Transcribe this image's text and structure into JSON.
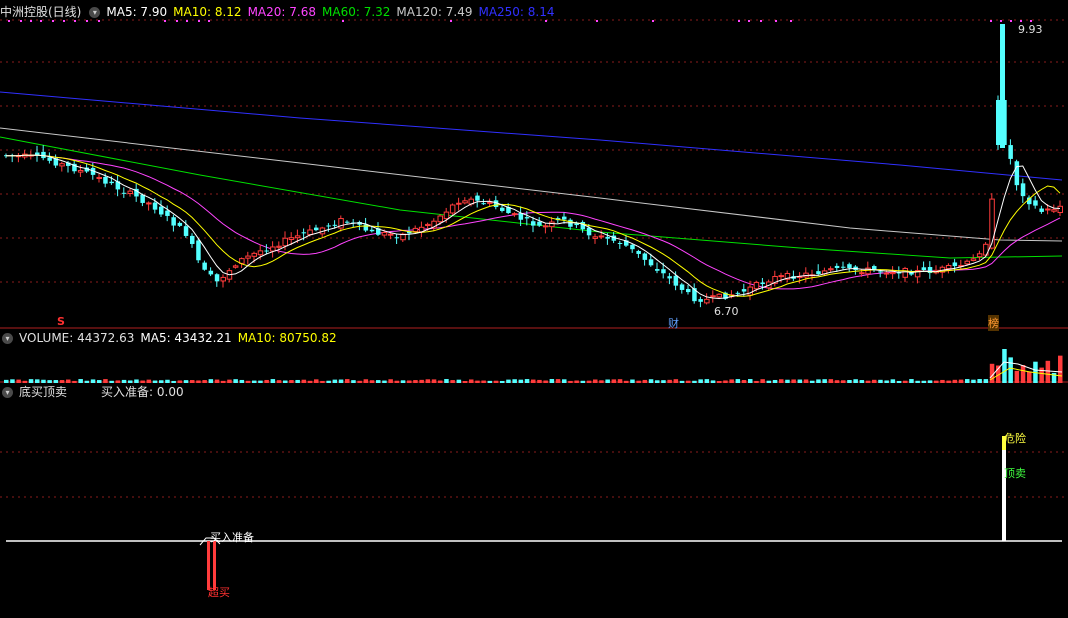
{
  "header": {
    "stock": "中洲控股(日线)",
    "ma5": "MA5: 7.90",
    "ma10": "MA10: 8.12",
    "ma20": "MA20: 7.68",
    "ma60": "MA60: 7.32",
    "ma120": "MA120: 7.49",
    "ma250": "MA250: 8.14"
  },
  "volume_header": {
    "label": "VOLUME: 44372.63",
    "ma5": "MA5: 43432.21",
    "ma10": "MA10: 80750.82"
  },
  "indicator_header": {
    "name": "底买顶卖",
    "value": "买入准备: 0.00"
  },
  "markers": {
    "s": "S",
    "cai": "财",
    "bang": "榜",
    "low_label": "6.70",
    "high_label": "9.93"
  },
  "indicator_labels": {
    "buy_prep": "买入准备",
    "chao_mai": "超买",
    "danger": "危险",
    "top_sell": "顶卖"
  },
  "colors": {
    "up": "#ff3c3c",
    "down": "#54ffff",
    "ma5": "#ffffff",
    "ma10": "#ffff00",
    "ma20": "#ff44ff",
    "ma60": "#00e000",
    "ma120": "#c8c8c8",
    "ma250": "#3030ff",
    "grid": "#8a1c1c"
  },
  "chart_data": {
    "type": "candlestick",
    "price_range_visible": [
      6.7,
      9.93
    ],
    "low_point": 6.7,
    "high_point": 9.93,
    "ma_values": {
      "MA5": 7.9,
      "MA10": 8.12,
      "MA20": 7.68,
      "MA60": 7.32,
      "MA120": 7.49,
      "MA250": 8.14
    },
    "volume": 44372.63,
    "volume_ma5": 43432.21,
    "volume_ma10": 80750.82,
    "indicator_value": 0.0
  }
}
